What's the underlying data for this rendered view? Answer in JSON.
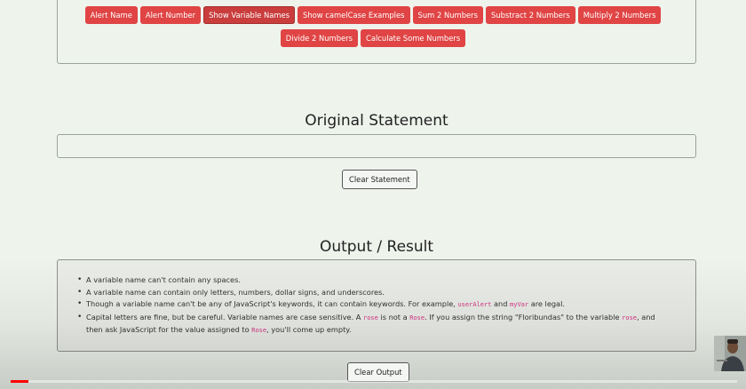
{
  "buttons_row1": [
    {
      "label": "Alert Name"
    },
    {
      "label": "Alert Number"
    },
    {
      "label": "Show Variable Names"
    },
    {
      "label": "Show camelCase Examples"
    },
    {
      "label": "Sum 2 Numbers"
    },
    {
      "label": "Substract 2 Numbers"
    },
    {
      "label": "Multiply 2 Numbers"
    }
  ],
  "buttons_row2": [
    {
      "label": "Divide 2 Numbers"
    },
    {
      "label": "Calculate Some Numbers"
    }
  ],
  "original": {
    "heading": "Original Statement",
    "clear_label": "Clear Statement"
  },
  "output": {
    "heading": "Output / Result",
    "clear_label": "Clear Output",
    "items": [
      {
        "t1": "A variable name can't contain any spaces."
      },
      {
        "t1": "A variable name can contain only letters, numbers, dollar signs, and underscores."
      },
      {
        "t1": "Though a variable name can't be any of JavaScript's keywords, it can contain keywords. For example, ",
        "c1": "userAlert",
        "t2": " and ",
        "c2": "myVar",
        "t3": " are legal."
      },
      {
        "t1": "Capital letters are fine, but be careful. Variable names are case sensitive. A ",
        "c1": "rose",
        "t2": " is not a ",
        "c2": "Rose",
        "t3": ". If you assign the string \"Floribundas\" to the variable ",
        "c3": "rose",
        "t4": ", and then ask JavaScript for the value assigned to ",
        "c4": "Rose",
        "t5": ", you'll come up empty."
      }
    ]
  },
  "video": {
    "progress": 0.025,
    "accent": "#ff0000"
  }
}
